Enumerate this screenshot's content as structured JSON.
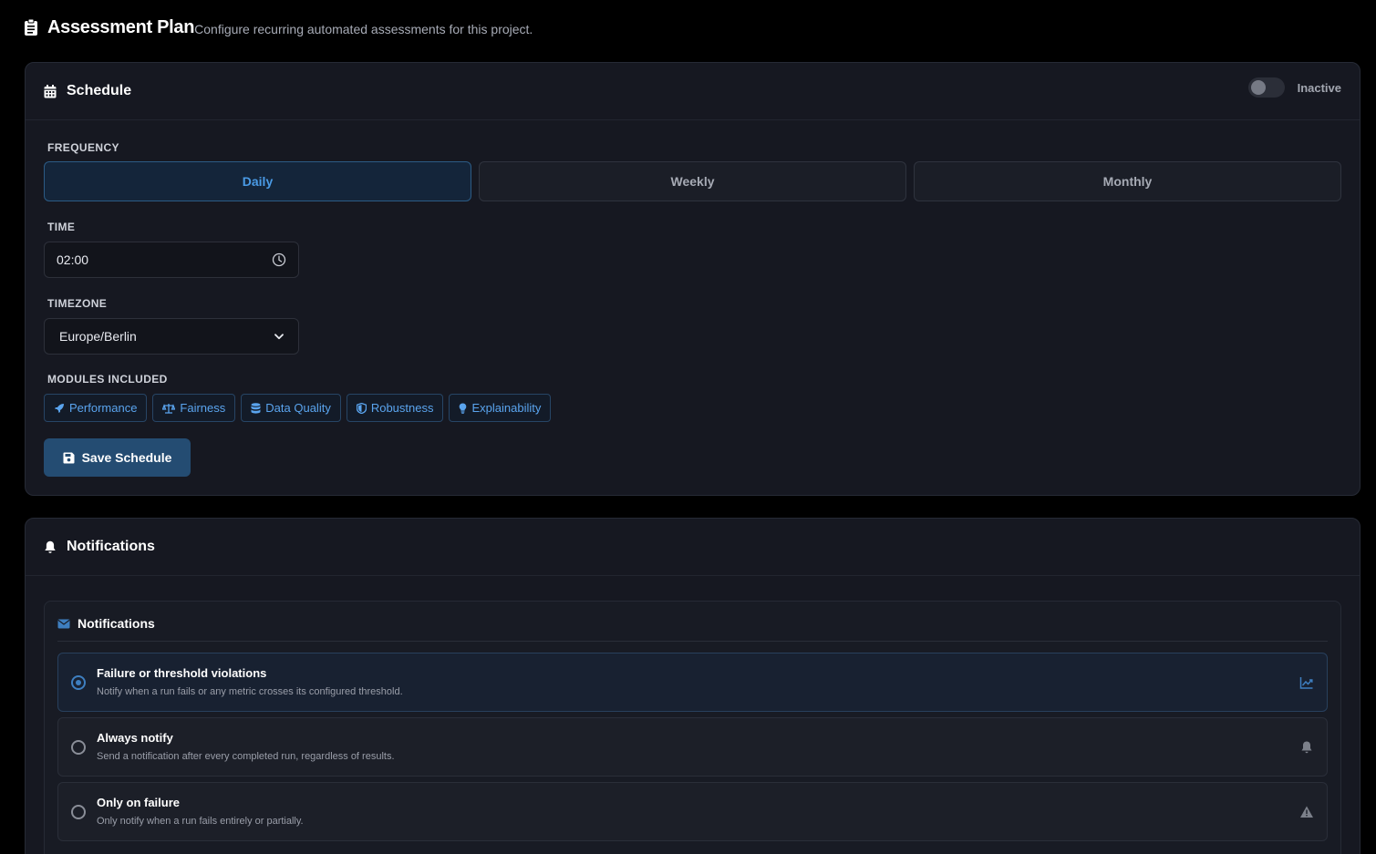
{
  "page": {
    "title": "Assessment Plan",
    "subtitle": "Configure recurring automated assessments for this project."
  },
  "schedule": {
    "title": "Schedule",
    "status_label": "Inactive",
    "active": false,
    "frequency_label": "FREQUENCY",
    "frequency_options": [
      "Daily",
      "Weekly",
      "Monthly"
    ],
    "frequency_selected": "Daily",
    "time_label": "TIME",
    "time_value": "02:00",
    "timezone_label": "TIMEZONE",
    "timezone_value": "Europe/Berlin",
    "modules_label": "MODULES INCLUDED",
    "modules": [
      {
        "label": "Performance",
        "icon": "rocket-icon"
      },
      {
        "label": "Fairness",
        "icon": "scale-icon"
      },
      {
        "label": "Data Quality",
        "icon": "database-icon"
      },
      {
        "label": "Robustness",
        "icon": "shield-icon"
      },
      {
        "label": "Explainability",
        "icon": "lightbulb-icon"
      }
    ],
    "save_label": "Save Schedule"
  },
  "notifications": {
    "title": "Notifications",
    "inner_title": "Notifications",
    "options": [
      {
        "title": "Failure or threshold violations",
        "description": "Notify when a run fails or any metric crosses its configured threshold.",
        "icon": "chart-line-icon",
        "selected": true
      },
      {
        "title": "Always notify",
        "description": "Send a notification after every completed run, regardless of results.",
        "icon": "bell-icon",
        "selected": false
      },
      {
        "title": "Only on failure",
        "description": "Only notify when a run fails entirely or partially.",
        "icon": "warning-icon",
        "selected": false
      }
    ]
  },
  "colors": {
    "background": "#000000",
    "card": "#161821",
    "accent": "#4a9be6",
    "save_button": "#244c72"
  }
}
